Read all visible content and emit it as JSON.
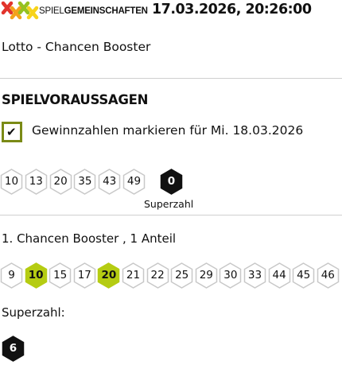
{
  "header": {
    "logo": {
      "text_light": "SPIEL",
      "text_bold": "GEMEINSCHAFTEN"
    },
    "timestamp": "17.03.2026, 20:26:00"
  },
  "game_title": "Lotto - Chancen Booster",
  "section_title": "SPIELVORAUSSAGEN",
  "mark_winning": {
    "checked": true,
    "label": "Gewinnzahlen markieren für Mi. 18.03.2026"
  },
  "drawn": {
    "numbers": [
      "10",
      "13",
      "20",
      "35",
      "43",
      "49"
    ],
    "superzahl": "0",
    "superzahl_label": "Superzahl"
  },
  "tip": {
    "title": "1. Chancen Booster , 1 Anteil",
    "numbers": [
      "9",
      "10",
      "15",
      "17",
      "20",
      "21",
      "22",
      "25",
      "29",
      "30",
      "33",
      "44",
      "45",
      "46"
    ],
    "hits": [
      "10",
      "20"
    ],
    "superzahl_label": "Superzahl:",
    "superzahl": "6"
  },
  "colors": {
    "hit": "#b5cc12",
    "ball_border": "#c8c8c8",
    "checkbox_border": "#7a8a16",
    "super_ball": "#111111"
  }
}
